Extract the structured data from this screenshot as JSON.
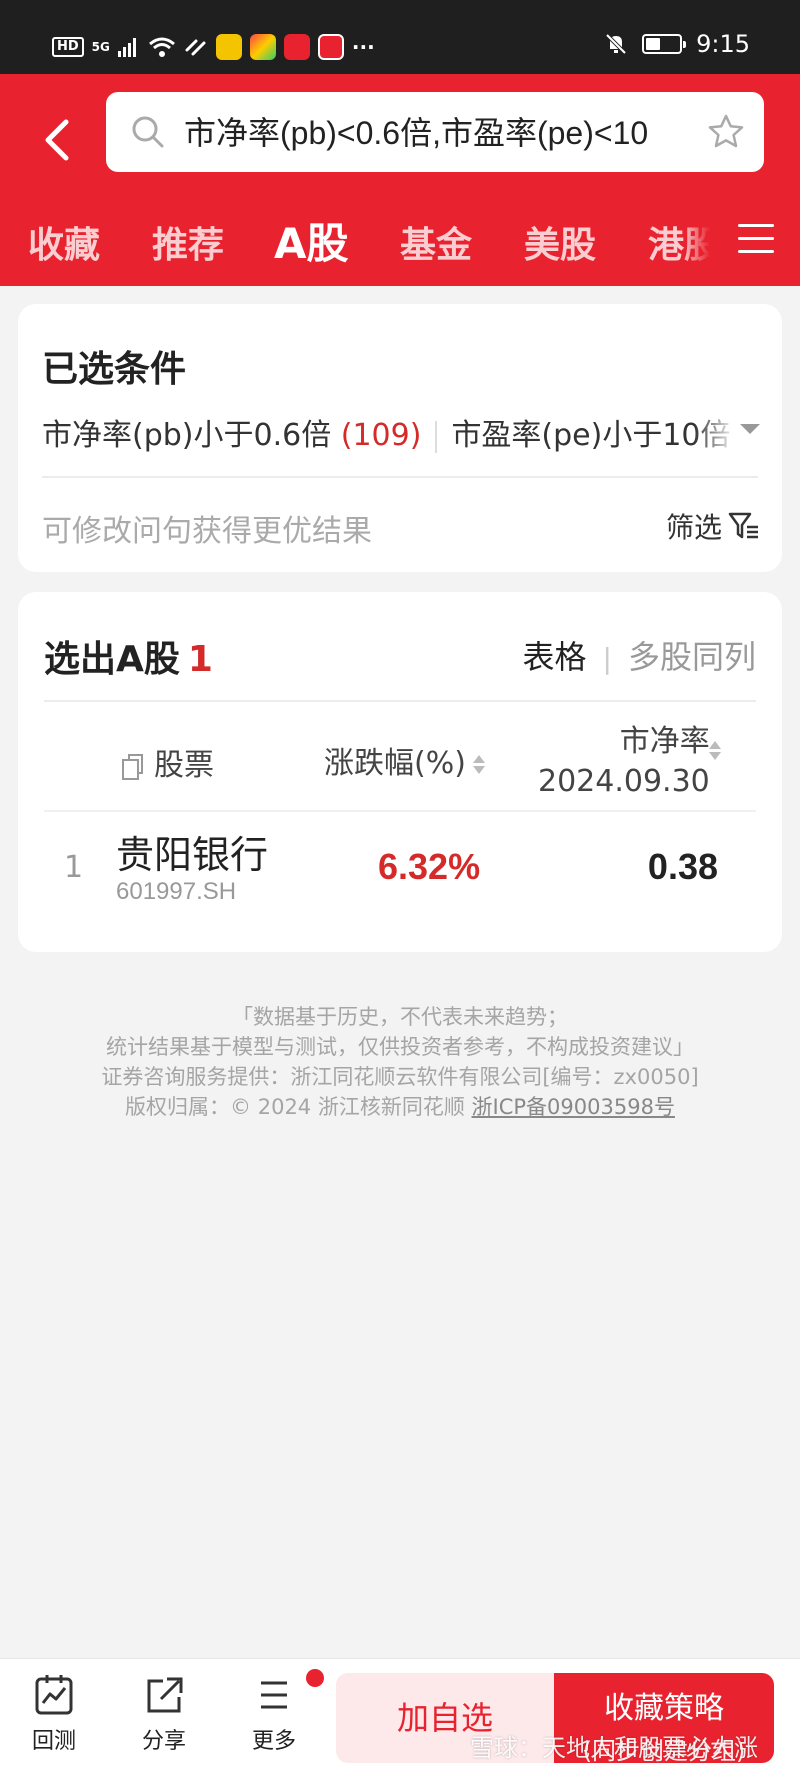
{
  "status_bar": {
    "network": "HD",
    "signal": "5G",
    "time": "9:15"
  },
  "header": {
    "search_query": "市净率(pb)<0.6倍,市盈率(pe)<10",
    "tabs": [
      "收藏",
      "推荐",
      "A股",
      "基金",
      "美股",
      "港股"
    ],
    "active_tab": "A股"
  },
  "conditions": {
    "title": "已选条件",
    "items": [
      {
        "label": "市净率(pb)小于0.6倍",
        "count": "(109)"
      },
      {
        "label": "市盈率(pe)小于10倍",
        "count": "("
      }
    ],
    "hint": "可修改问句获得更优结果",
    "filter_label": "筛选"
  },
  "results": {
    "title": "选出A股",
    "count": "1",
    "view_table": "表格",
    "view_multi": "多股同列",
    "columns": {
      "stock": "股票",
      "change": "涨跌幅(%)",
      "pb": "市净率",
      "pb_date": "2024.09.30"
    },
    "rows": [
      {
        "index": "1",
        "name": "贵阳银行",
        "code": "601997.SH",
        "change": "6.32%",
        "pb": "0.38"
      }
    ]
  },
  "disclaimer": {
    "line1": "「数据基于历史，不代表未来趋势；",
    "line2": "统计结果基于模型与测试，仅供投资者参考，不构成投资建议」",
    "line3": "证券咨询服务提供：浙江同花顺云软件有限公司[编号：zx0050]",
    "line4": "版权归属：© 2024 浙江核新同花顺",
    "icp": "浙ICP备09003598号"
  },
  "bottom_bar": {
    "backtest": "回测",
    "share": "分享",
    "more": "更多",
    "add_watch": "加自选",
    "fav_strategy": "收藏策略",
    "fav_strategy_sub": "(同步创建分组)"
  },
  "watermark": "雪球：天地人和股票必大涨",
  "colors": {
    "brand_red": "#e8232f",
    "rise_red": "#d42a2a"
  }
}
